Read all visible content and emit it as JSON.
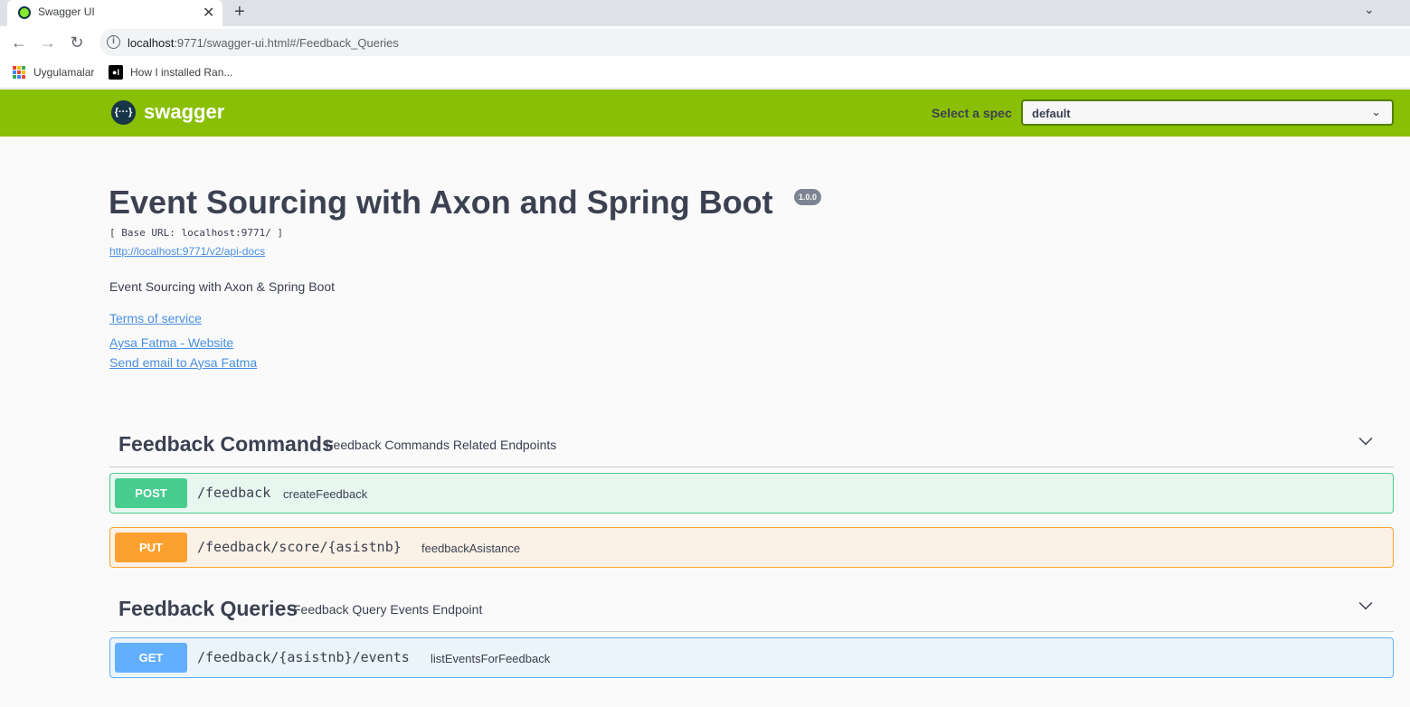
{
  "browser": {
    "tab_title": "Swagger UI",
    "close_glyph": "✕",
    "new_tab_glyph": "+",
    "menu_glyph": "⌄",
    "back_glyph": "←",
    "forward_glyph": "→",
    "reload_glyph": "↻",
    "url_host": "localhost",
    "url_rest": ":9771/swagger-ui.html#/Feedback_Queries",
    "bookmarks": [
      "Uygulamalar",
      "How I installed Ran..."
    ]
  },
  "topbar": {
    "logo_text": "swagger",
    "logo_icon": "{···}",
    "spec_label": "Select a spec",
    "spec_value": "default",
    "chevron": "⌄"
  },
  "info": {
    "title": "Event Sourcing with Axon and Spring Boot",
    "version": "1.0.0",
    "base_url": "[ Base URL: localhost:9771/ ]",
    "api_docs_link": "http://localhost:9771/v2/api-docs",
    "description": "Event Sourcing with Axon & Spring Boot",
    "terms": "Terms of service",
    "contact_website": "Aysa Fatma - Website",
    "contact_email": "Send email to Aysa Fatma"
  },
  "tags": [
    {
      "name": "Feedback Commands",
      "description": "Feedback Commands Related Endpoints",
      "operations": [
        {
          "method": "POST",
          "path": "/feedback",
          "summary": "createFeedback"
        },
        {
          "method": "PUT",
          "path": "/feedback/score/{asistnb}",
          "summary": "feedbackAsistance"
        }
      ]
    },
    {
      "name": "Feedback Queries",
      "description": "Feedback Query Events Endpoint",
      "operations": [
        {
          "method": "GET",
          "path": "/feedback/{asistnb}/events",
          "summary": "listEventsForFeedback"
        }
      ]
    }
  ],
  "colors": {
    "topbar": "#89bf04",
    "post": "#49cc90",
    "put": "#fca130",
    "get": "#61affe",
    "link": "#4990e2"
  }
}
